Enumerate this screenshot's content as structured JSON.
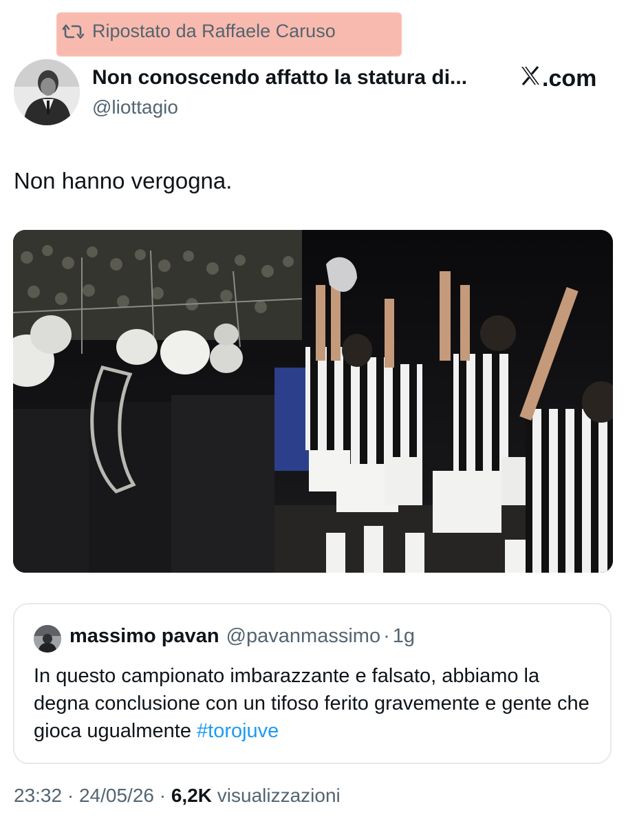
{
  "repost": {
    "label": "Ripostato da Raffaele Caruso",
    "highlight_color": "#f8b5a8"
  },
  "header": {
    "display_name": "Non conoscendo affatto la statura di...",
    "handle": "@liottagio",
    "brand": "X.com",
    "brand_icon": "x-logo-icon",
    "avatar": "avatar"
  },
  "tweet": {
    "text": "Non hanno vergogna.",
    "media": "photo"
  },
  "quote": {
    "name": "massimo pavan",
    "handle": "@pavanmassimo",
    "separator": "·",
    "time": "1g",
    "text": "In questo campionato imbarazzante e falsato, abbiamo la degna conclusione con un tifoso ferito gravemente e gente che gioca ugualmente",
    "hashtag": "#torojuve"
  },
  "footer": {
    "time": "23:32",
    "sep1": "·",
    "date": "24/05/26",
    "sep2": "·",
    "views_count": "6,2K",
    "views_label": "visualizzazioni"
  },
  "colors": {
    "text_primary": "#0f1419",
    "text_secondary": "#536471",
    "link": "#1d9bf0",
    "border": "#e6e9ec"
  }
}
